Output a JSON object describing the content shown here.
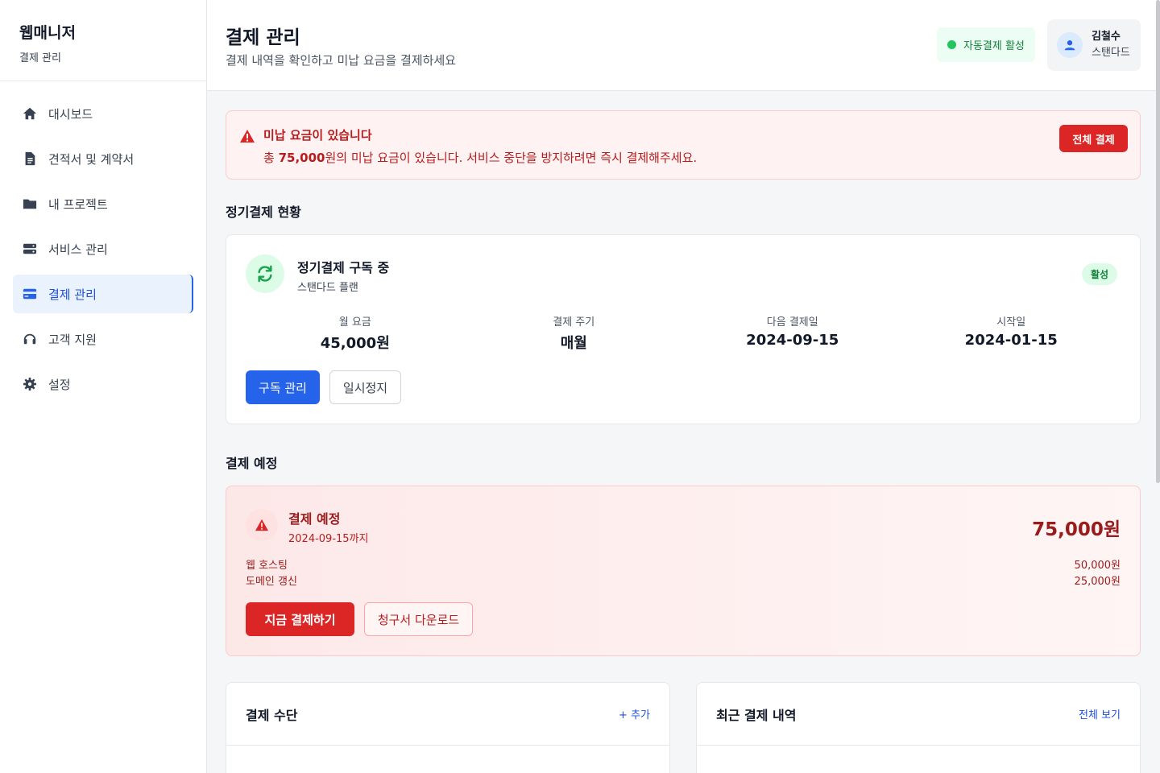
{
  "brand": {
    "name": "웹매니저",
    "subtitle": "결제 관리"
  },
  "sidebar": {
    "items": [
      {
        "label": "대시보드",
        "icon": "home-icon"
      },
      {
        "label": "견적서 및 계약서",
        "icon": "document-icon"
      },
      {
        "label": "내 프로젝트",
        "icon": "folder-icon"
      },
      {
        "label": "서비스 관리",
        "icon": "server-icon"
      },
      {
        "label": "결제 관리",
        "icon": "credit-card-icon",
        "active": true
      },
      {
        "label": "고객 지원",
        "icon": "headset-icon"
      },
      {
        "label": "설정",
        "icon": "gear-icon"
      }
    ]
  },
  "header": {
    "title": "결제 관리",
    "subtitle": "결제 내역을 확인하고 미납 요금을 결제하세요",
    "autopay_status": "자동결제 활성",
    "user": {
      "name": "김철수",
      "plan": "스탠다드"
    }
  },
  "alert": {
    "title": "미납 요금이 있습니다",
    "body_prefix": "총 ",
    "amount": "75,000",
    "body_suffix": "원의 미납 요금이 있습니다. 서비스 중단을 방지하려면 즉시 결제해주세요.",
    "button": "전체 결제"
  },
  "subscription_section": {
    "title": "정기결제 현황",
    "name": "정기결제 구독 중",
    "plan": "스탠다드 플랜",
    "badge": "활성",
    "stats": [
      {
        "label": "월 요금",
        "value": "45,000원"
      },
      {
        "label": "결제 주기",
        "value": "매월"
      },
      {
        "label": "다음 결제일",
        "value": "2024-09-15"
      },
      {
        "label": "시작일",
        "value": "2024-01-15"
      }
    ],
    "manage_button": "구독 관리",
    "pause_button": "일시정지"
  },
  "due_section": {
    "title": "결제 예정",
    "card_title": "결제 예정",
    "due_date": "2024-09-15까지",
    "total": "75,000원",
    "items": [
      {
        "name": "웹 호스팅",
        "amount": "50,000원"
      },
      {
        "name": "도메인 갱신",
        "amount": "25,000원"
      }
    ],
    "pay_button": "지금 결제하기",
    "invoice_button": "청구서 다운로드"
  },
  "payment_methods": {
    "title": "결제 수단",
    "action": "+ 추가"
  },
  "recent_payments": {
    "title": "최근 결제 내역",
    "action": "전체 보기"
  },
  "colors": {
    "primary": "#2563eb",
    "danger": "#dc2626",
    "success": "#22c55e"
  }
}
